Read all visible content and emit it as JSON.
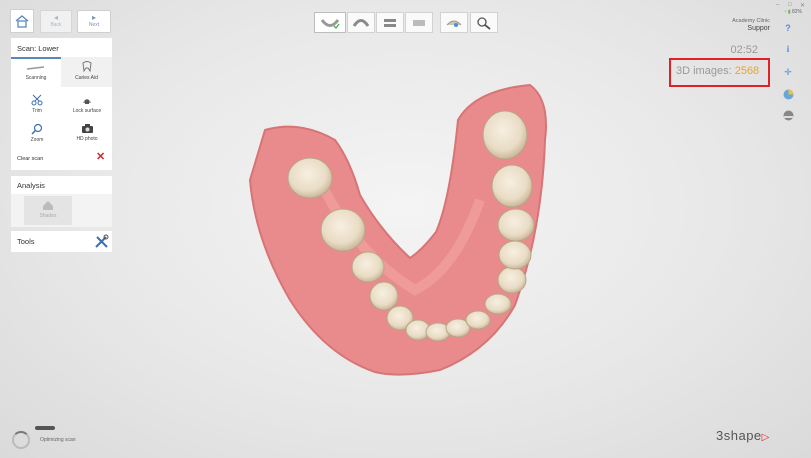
{
  "nav": {
    "back_label": "Back",
    "next_label": "Next"
  },
  "scan_panel": {
    "title": "Scan: Lower",
    "tabs": [
      {
        "label": "Scanning"
      },
      {
        "label": "Caries Aid"
      }
    ],
    "tools": [
      {
        "label": "Trim",
        "icon": "scissors-icon"
      },
      {
        "label": "Lock surface",
        "icon": "lock-surface-icon"
      },
      {
        "label": "Zoom",
        "icon": "zoom-icon"
      },
      {
        "label": "HD photo",
        "icon": "camera-icon"
      }
    ],
    "clear_scan_label": "Clear scan"
  },
  "analysis_panel": {
    "title": "Analysis",
    "item_label": "Shades"
  },
  "tools_panel": {
    "title": "Tools"
  },
  "status": {
    "clinic": "Academy Clinic",
    "user": "Suppor",
    "battery": "82%",
    "timer": "02:52",
    "images_label": "3D images: ",
    "images_count": "2568"
  },
  "footer": {
    "status_text": "Optimizing scan",
    "brand": "3shape"
  },
  "colors": {
    "accent": "#4a90d9",
    "count": "#e8a33a",
    "highlight": "#e0202a",
    "gum": "#e88a8c",
    "tooth": "#efe4d2"
  }
}
